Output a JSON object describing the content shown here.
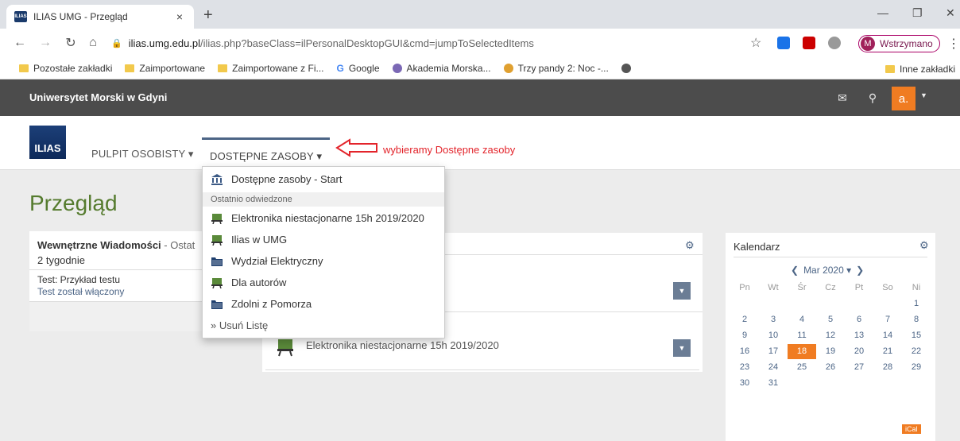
{
  "browser": {
    "tab_title": "ILIAS UMG - Przegląd",
    "favicon_text": "ILIAS",
    "tab_close": "×",
    "new_tab": "+",
    "url_host": "ilias.umg.edu.pl",
    "url_rest": "/ilias.php?baseClass=ilPersonalDesktopGUI&cmd=jumpToSelectedItems",
    "profile_initial": "M",
    "profile_label": "Wstrzymano",
    "bookmarks": [
      "Pozostałe zakładki",
      "Zaimportowane",
      "Zaimportowane z Fi...",
      "Google",
      "Akademia Morska...",
      "Trzy pandy 2: Noc -..."
    ],
    "other_bookmarks": "Inne zakładki"
  },
  "ilias": {
    "institution": "Uniwersytet Morski w Gdyni",
    "logo_text": "ILIAS",
    "user_initial": "a.",
    "nav": {
      "desktop": "PULPIT OSOBISTY ▾",
      "repository": "DOSTĘPNE ZASOBY ▾"
    },
    "annotation": "wybieramy Dostępne zasoby"
  },
  "dropdown": {
    "start": "Dostępne zasoby - Start",
    "group_label": "Ostatnio odwiedzone",
    "items": [
      {
        "label": "Elektronika niestacjonarne 15h 2019/2020",
        "icon": "course-icon"
      },
      {
        "label": "Ilias w UMG",
        "icon": "course-icon"
      },
      {
        "label": "Wydział Elektryczny",
        "icon": "category-icon"
      },
      {
        "label": "Dla autorów",
        "icon": "course-icon"
      },
      {
        "label": "Zdolni z Pomorza",
        "icon": "category-icon"
      }
    ],
    "clear": "» Usuń Listę"
  },
  "page": {
    "title": "Przegląd"
  },
  "messages": {
    "title": "Wewnętrzne Wiadomości",
    "title_suffix": " - Ostat",
    "period": "2 tygodnie",
    "item_title": "Test: Przykład testu",
    "item_link": "Test został włączony"
  },
  "center": {
    "course_title": "Elektronika niestacjonarne 15h 2019/2020"
  },
  "calendar": {
    "title": "Kalendarz",
    "month": "Mar 2020 ▾",
    "weekdays": [
      "Pn",
      "Wt",
      "Śr",
      "Cz",
      "Pt",
      "So",
      "Ni"
    ],
    "weeks": [
      [
        "",
        "",
        "",
        "",
        "",
        "",
        "1"
      ],
      [
        "2",
        "3",
        "4",
        "5",
        "6",
        "7",
        "8"
      ],
      [
        "9",
        "10",
        "11",
        "12",
        "13",
        "14",
        "15"
      ],
      [
        "16",
        "17",
        "18",
        "19",
        "20",
        "21",
        "22"
      ],
      [
        "23",
        "24",
        "25",
        "26",
        "27",
        "28",
        "29"
      ],
      [
        "30",
        "31",
        "",
        "",
        "",
        "",
        ""
      ]
    ],
    "today": "18",
    "ical": "iCal"
  }
}
